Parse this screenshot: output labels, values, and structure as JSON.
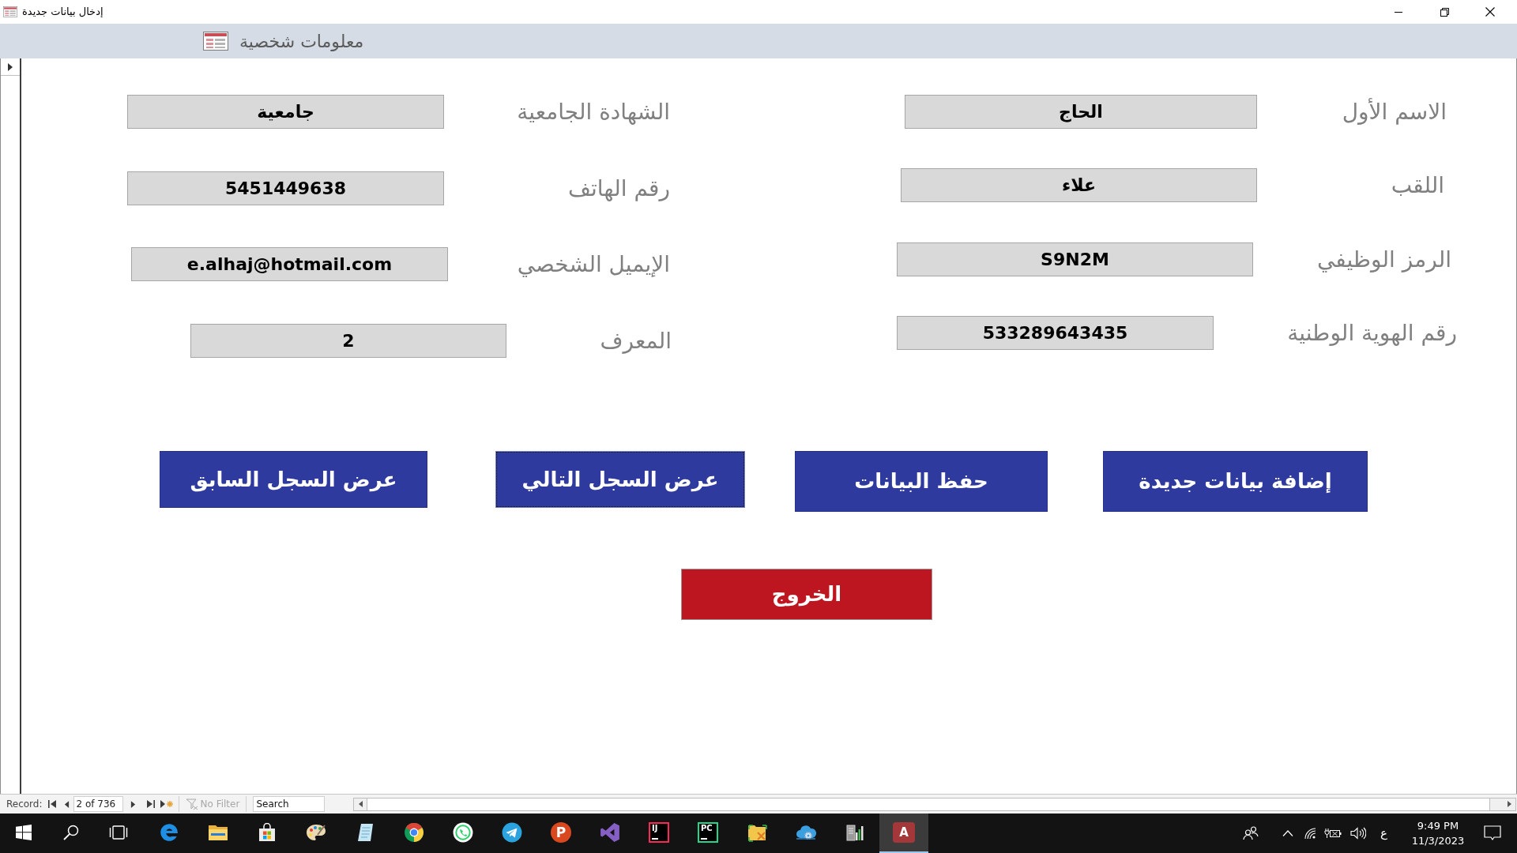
{
  "window": {
    "title": "إدخال بيانات جديدة"
  },
  "form_header": {
    "title": "معلومات شخصية"
  },
  "form": {
    "right_column": [
      {
        "label": "الاسم الأول",
        "value": "الحاج"
      },
      {
        "label": "اللقب",
        "value": "علاء"
      },
      {
        "label": "الرمز الوظيفي",
        "value": "S9N2M"
      },
      {
        "label": "رقم الهوية الوطنية",
        "value": "533289643435"
      }
    ],
    "left_column": [
      {
        "label": "الشهادة الجامعية",
        "value": "جامعية"
      },
      {
        "label": "رقم الهاتف",
        "value": "5451449638"
      },
      {
        "label": "الإيميل الشخصي",
        "value": "e.alhaj@hotmail.com"
      },
      {
        "label": "المعرف",
        "value": "2"
      }
    ]
  },
  "buttons": [
    {
      "label": "إضافة بيانات جديدة",
      "focused": false
    },
    {
      "label": "حفظ البيانات",
      "focused": false
    },
    {
      "label": "عرض السجل التالي",
      "focused": true
    },
    {
      "label": "عرض السجل السابق",
      "focused": false
    }
  ],
  "exit_button": {
    "label": "الخروج"
  },
  "record_navigation": {
    "label": "Record:",
    "position": "2 of 736",
    "filter": {
      "label": "No Filter",
      "active": false
    },
    "search": {
      "placeholder": "Search"
    }
  },
  "taskbar": {
    "items": [
      {
        "kind": "filled_tile",
        "glyph": "A",
        "color": "#a4373a",
        "selected": true
      },
      {
        "kind": "server_chart",
        "selected": false
      },
      {
        "kind": "cloud_gear",
        "selected": false
      },
      {
        "kind": "folder_tools",
        "selected": false
      },
      {
        "kind": "outlined_tile",
        "glyph": "PC",
        "color": "#21d789",
        "selected": false
      },
      {
        "kind": "outlined_tile",
        "glyph": "IJ",
        "color": "#fe2857",
        "selected": false
      },
      {
        "kind": "ribbon",
        "selected": false
      },
      {
        "kind": "letter_circle",
        "glyph": "P",
        "color": "#d9481e",
        "selected": false
      },
      {
        "kind": "paper_plane",
        "selected": false
      },
      {
        "kind": "phone_bubble",
        "selected": false
      },
      {
        "kind": "round_logo",
        "selected": false
      },
      {
        "kind": "notebook",
        "selected": false
      },
      {
        "kind": "palette",
        "selected": false
      },
      {
        "kind": "bag",
        "selected": false
      },
      {
        "kind": "folder",
        "selected": false
      },
      {
        "kind": "swirl",
        "selected": false
      },
      {
        "kind": "task_view",
        "selected": false
      },
      {
        "kind": "search",
        "selected": false
      },
      {
        "kind": "start",
        "selected": false
      }
    ],
    "tray": {
      "input_language": "ع",
      "time": "9:49 PM",
      "date": "11/3/2023"
    }
  }
}
